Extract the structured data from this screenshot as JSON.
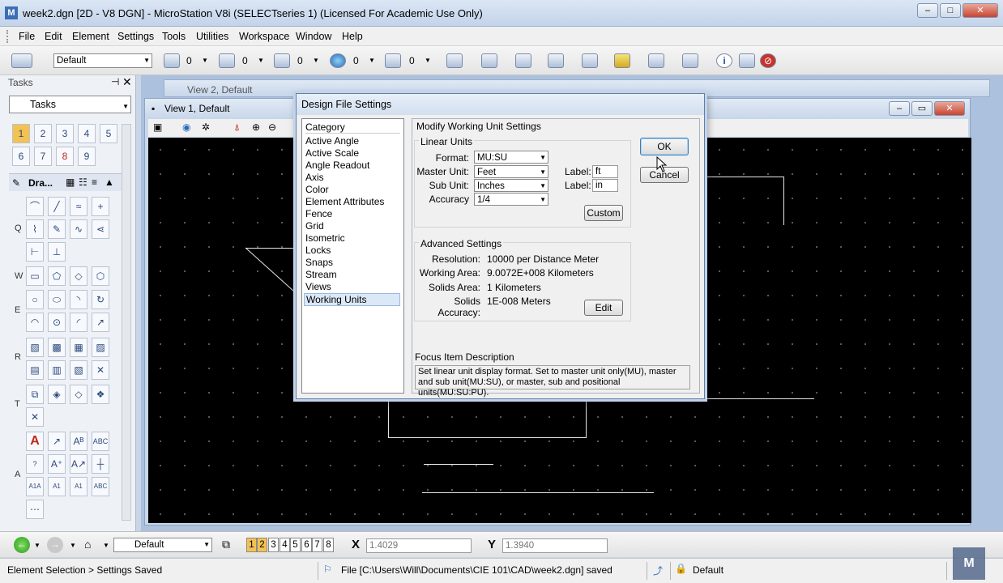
{
  "window": {
    "title": "week2.dgn [2D - V8 DGN] - MicroStation V8i (SELECTseries 1) (Licensed For Academic Use Only)",
    "min": "–",
    "max": "□",
    "close": "✕"
  },
  "menu": [
    "File",
    "Edit",
    "Element",
    "Settings",
    "Tools",
    "Utilities",
    "Workspace",
    "Window",
    "Help"
  ],
  "toolbar": {
    "level": "Default",
    "counts": [
      "0",
      "0",
      "0",
      "0",
      "0"
    ]
  },
  "tasks": {
    "title": "Tasks",
    "pin": "⊣",
    "close": "✕",
    "combo": "Tasks",
    "drawing": "Dra...",
    "tool_numbers": [
      "1",
      "2",
      "3",
      "4",
      "5",
      "6",
      "7",
      "8",
      "9"
    ],
    "rows": [
      "Q",
      "W",
      "E",
      "R",
      "T",
      "A"
    ]
  },
  "views": {
    "view2": "View 2, Default",
    "view1": "View 1, Default"
  },
  "dialog": {
    "title": "Design File Settings",
    "category_header": "Category",
    "categories": [
      "Active Angle",
      "Active Scale",
      "Angle Readout",
      "Axis",
      "Color",
      "Element Attributes",
      "Fence",
      "Grid",
      "Isometric",
      "Locks",
      "Snaps",
      "Stream",
      "Views",
      "Working Units"
    ],
    "panel_title": "Modify Working Unit Settings",
    "linear_units": "Linear Units",
    "format_label": "Format:",
    "format_value": "MU:SU",
    "master_label": "Master Unit:",
    "master_value": "Feet",
    "sub_label": "Sub Unit:",
    "sub_value": "Inches",
    "accuracy_label": "Accuracy",
    "accuracy_value": "1/4",
    "label1": "Label:",
    "label1_value": "ft",
    "label2": "Label:",
    "label2_value": "in",
    "custom": "Custom",
    "advanced": "Advanced Settings",
    "resolution_label": "Resolution:",
    "resolution_value": "10000 per Distance Meter",
    "working_area_label": "Working Area:",
    "working_area_value": "9.0072E+008 Kilometers",
    "solids_area_label": "Solids Area:",
    "solids_area_value": "1 Kilometers",
    "solids_acc_label": "Solids Accuracy:",
    "solids_acc_value": "1E-008 Meters",
    "edit": "Edit",
    "focus_title": "Focus Item Description",
    "focus_text": "Set linear unit display format.  Set to master unit only(MU), master and sub unit(MU:SU), or master, sub and positional units(MU:SU:PU).",
    "ok": "OK",
    "cancel": "Cancel"
  },
  "bottom": {
    "level": "Default",
    "views": [
      "1",
      "2",
      "3",
      "4",
      "5",
      "6",
      "7",
      "8"
    ],
    "x_label": "X",
    "x_value": "1.4029",
    "y_label": "Y",
    "y_value": "1.3940"
  },
  "status": {
    "left": "Element Selection > Settings Saved",
    "file": "File [C:\\Users\\Will\\Documents\\CIE 101\\CAD\\week2.dgn] saved",
    "level": "Default"
  }
}
